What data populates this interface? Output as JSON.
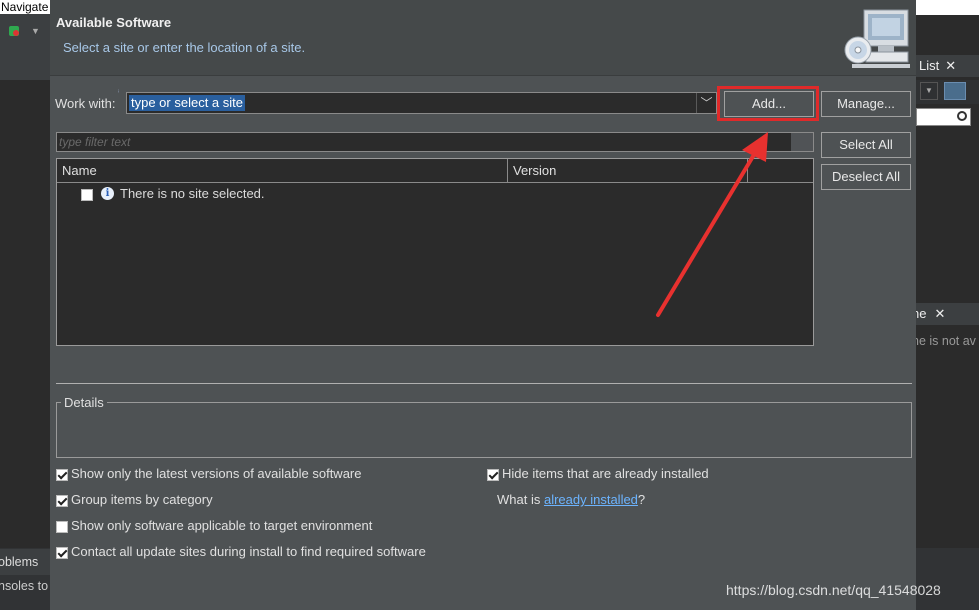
{
  "background": {
    "nav_label": "Navigate",
    "right_panel_label": "List",
    "right_panel2_label": "ne",
    "right_text": "ne is not av",
    "problems_label": "oblems",
    "consoles_label": "nsoles to"
  },
  "dialog": {
    "title": "Available Software",
    "subtitle": "Select a site or enter the location of a site.",
    "work_with_label": "Work with:",
    "work_with_value": "type or select a site",
    "add_button": "Add...",
    "manage_button": "Manage...",
    "filter_placeholder": "type filter text",
    "select_all_button": "Select All",
    "deselect_all_button": "Deselect All",
    "table": {
      "columns": [
        "Name",
        "Version"
      ],
      "rows": [
        {
          "text": "There is no site selected.",
          "checked": false
        }
      ]
    },
    "details_label": "Details",
    "options": {
      "latest_versions": {
        "label": "Show only the latest versions of available software",
        "checked": true
      },
      "group_by_category": {
        "label": "Group items by category",
        "checked": true
      },
      "applicable_only": {
        "label": "Show only software applicable to target environment",
        "checked": false
      },
      "contact_all_sites": {
        "label": "Contact all update sites during install to find required software",
        "checked": true
      },
      "hide_installed": {
        "label": "Hide items that are already installed",
        "checked": true
      }
    },
    "what_is_prefix": "What is ",
    "already_installed_link": "already installed",
    "what_is_suffix": "?"
  },
  "annotation": {
    "highlight_color": "#e02a2a"
  },
  "watermark": "https://blog.csdn.net/qq_41548028"
}
